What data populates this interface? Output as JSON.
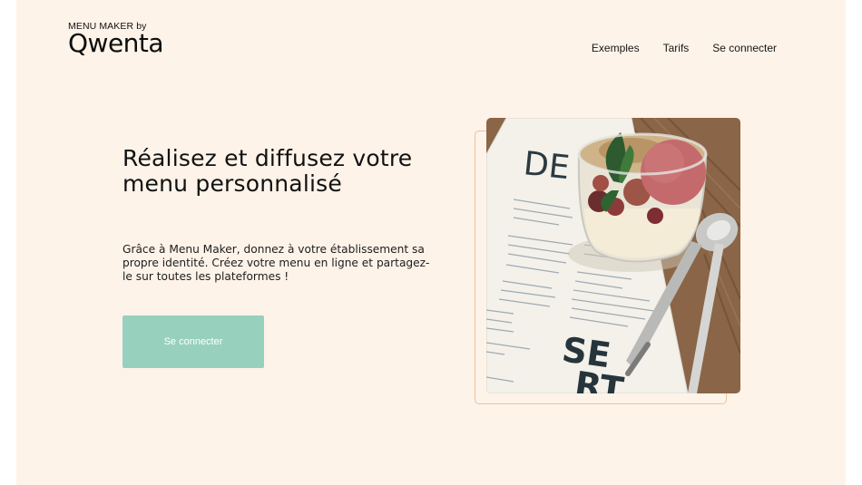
{
  "brand": {
    "small_text": "MENU MAKER by",
    "name": "Qwenta"
  },
  "nav": {
    "items": [
      {
        "label": "Exemples"
      },
      {
        "label": "Tarifs"
      },
      {
        "label": "Se connecter"
      }
    ]
  },
  "hero": {
    "title": "Réalisez et diffusez votre menu personnalisé",
    "description": "Grâce à Menu Maker, donnez à votre établissement sa propre identité. Créez votre menu en ligne et partagez-le sur toutes les plateformes !",
    "cta_label": "Se connecter"
  },
  "photo": {
    "menu_text_top": "DE",
    "menu_text_bottom_1": "SE",
    "menu_text_bottom_2": "RT"
  },
  "colors": {
    "page_background": "#fef3e9",
    "cta_background": "#98d0be",
    "frame_border": "#ebc29e"
  }
}
